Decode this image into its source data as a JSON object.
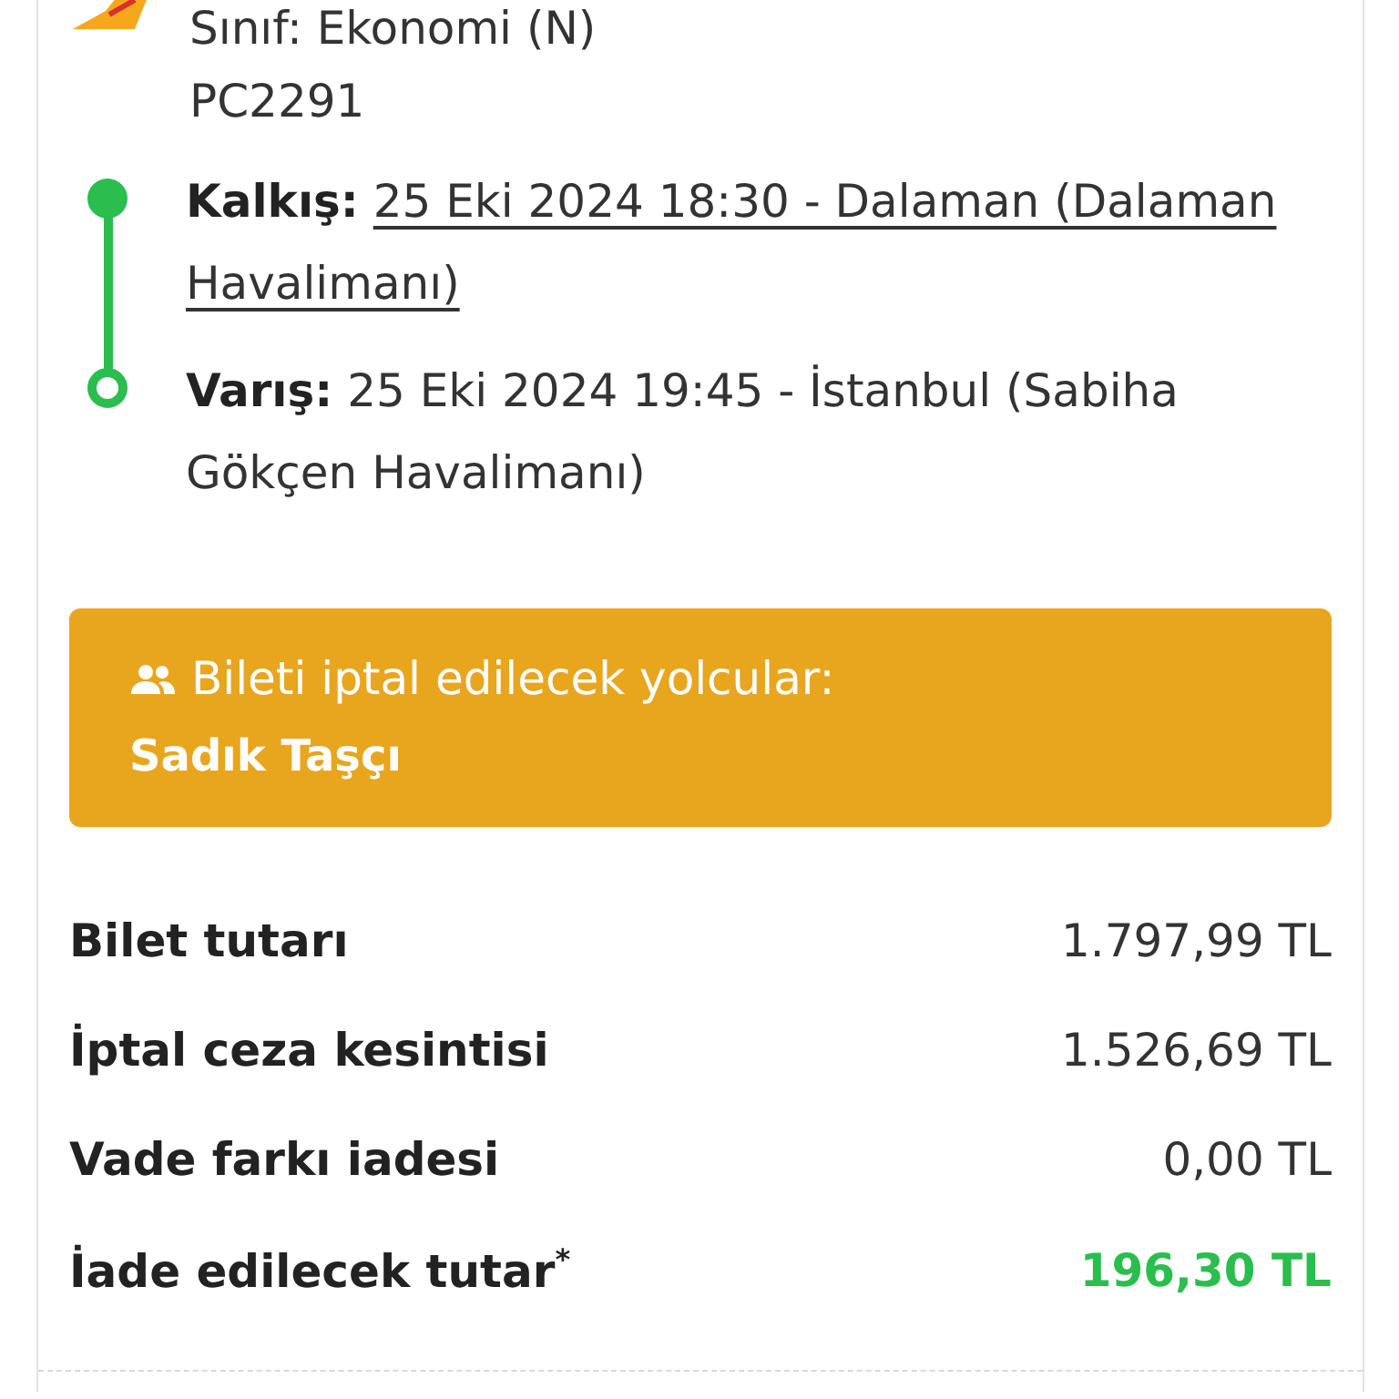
{
  "flight": {
    "class": "Sınıf: Ekonomi (N)",
    "number": "PC2291",
    "stops": [
      {
        "kind": "departure",
        "label": "Kalkış:",
        "value": "25 Eki 2024 18:30 - Dalaman (Dalaman Havalimanı)",
        "link": true
      },
      {
        "kind": "arrival",
        "label": "Varış:",
        "value": "25 Eki 2024 19:45 - İstanbul (Sabiha Gökçen Havalimanı)",
        "link": false
      }
    ]
  },
  "passengers": {
    "title": "Bileti iptal edilecek yolcular:",
    "names": [
      "Sadık Taşçı"
    ]
  },
  "amounts": [
    {
      "label": "Bilet tutarı",
      "value": "1.797,99 TL",
      "highlight": false
    },
    {
      "label": "İptal ceza kesintisi",
      "value": "1.526,69 TL",
      "highlight": false
    },
    {
      "label": "Vade farkı iadesi",
      "value": "0,00 TL",
      "highlight": false
    },
    {
      "label": "İade edilecek tutar$^{*}$",
      "value": "196,30 TL",
      "highlight": true
    }
  ]
}
